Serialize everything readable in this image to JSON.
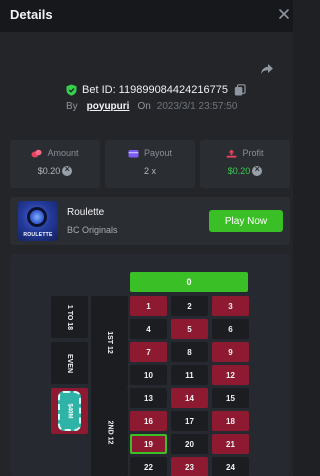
{
  "header": {
    "title": "Details",
    "close_icon": "close-icon"
  },
  "bet": {
    "id_text": "Bet ID: 119899084424216775",
    "by_label": "By",
    "username": "poyupuri",
    "on_label": "On",
    "date": "2023/3/1 23:57:50",
    "shield_icon": "shield-check-icon",
    "copy_icon": "copy-icon",
    "share_icon": "share-icon"
  },
  "stats": {
    "amount": {
      "label": "Amount",
      "value": "$0.20",
      "icon": "coins-icon"
    },
    "payout": {
      "label": "Payout",
      "value": "2 x",
      "icon": "wallet-icon"
    },
    "profit": {
      "label": "Profit",
      "value": "$0.20",
      "icon": "profit-icon"
    }
  },
  "game": {
    "name": "Roulette",
    "provider": "BC Originals",
    "thumb_caption": "ROULETTE",
    "play_label": "Play Now"
  },
  "table": {
    "zero": "0",
    "side_labels": {
      "low": "1 TO 18",
      "even": "EVEN",
      "dozen1": "1ST 12",
      "dozen2": "2ND 12"
    },
    "chip_label": "$40M",
    "selected": "19",
    "rows": [
      [
        {
          "n": "1",
          "c": "red"
        },
        {
          "n": "2",
          "c": "black"
        },
        {
          "n": "3",
          "c": "red"
        }
      ],
      [
        {
          "n": "4",
          "c": "black"
        },
        {
          "n": "5",
          "c": "red"
        },
        {
          "n": "6",
          "c": "black"
        }
      ],
      [
        {
          "n": "7",
          "c": "red"
        },
        {
          "n": "8",
          "c": "black"
        },
        {
          "n": "9",
          "c": "red"
        }
      ],
      [
        {
          "n": "10",
          "c": "black"
        },
        {
          "n": "11",
          "c": "black"
        },
        {
          "n": "12",
          "c": "red"
        }
      ],
      [
        {
          "n": "13",
          "c": "black"
        },
        {
          "n": "14",
          "c": "red"
        },
        {
          "n": "15",
          "c": "black"
        }
      ],
      [
        {
          "n": "16",
          "c": "red"
        },
        {
          "n": "17",
          "c": "black"
        },
        {
          "n": "18",
          "c": "red"
        }
      ],
      [
        {
          "n": "19",
          "c": "red"
        },
        {
          "n": "20",
          "c": "black"
        },
        {
          "n": "21",
          "c": "red"
        }
      ],
      [
        {
          "n": "22",
          "c": "black"
        },
        {
          "n": "23",
          "c": "red"
        },
        {
          "n": "24",
          "c": "black"
        }
      ]
    ]
  },
  "colors": {
    "accent_green": "#3bbf27",
    "red": "#8e1a32",
    "black": "#1b1d21"
  }
}
